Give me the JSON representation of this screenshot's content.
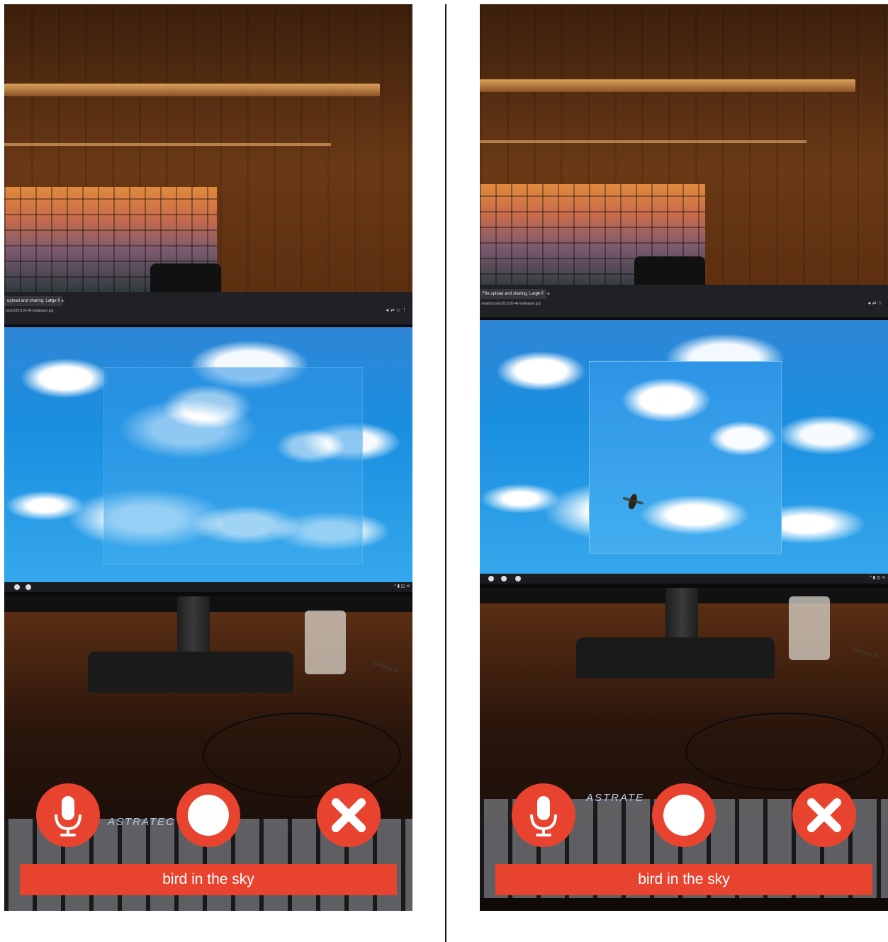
{
  "panels": [
    {
      "browser": {
        "tab_title": "upload and sharing. Large fi",
        "tab_close": "×",
        "new_tab": "+",
        "url": "posts/351193-4k-wallpaper.jpg",
        "toolbar": "● ⇄ ☆ ⋮"
      },
      "tray": "^ ▮ ◫ ⊲",
      "desk_label": "Galaxy A",
      "keyboard_label": "ASTRATEC",
      "caption": "bird in the sky",
      "controls": {
        "mic_icon": "microphone-icon",
        "shutter_icon": "shutter-icon",
        "close_icon": "close-icon"
      },
      "shows_bird": false
    },
    {
      "browser": {
        "tab_title": "File upload and sharing. Large fi",
        "tab_close": "×",
        "new_tab": "+",
        "url": "oloads/posts/351193-4k-wallpaper.jpg",
        "toolbar": "● ⇄ ☆"
      },
      "tray": "^ ▮ ◫ ⊲",
      "desk_label": "Galaxy A",
      "keyboard_label": "ASTRATE",
      "caption": "bird in the sky",
      "controls": {
        "mic_icon": "microphone-icon",
        "shutter_icon": "shutter-icon",
        "close_icon": "close-icon"
      },
      "shows_bird": true
    }
  ],
  "colors": {
    "accent": "#e8432f",
    "icon": "#ffffff",
    "divider": "#1a1a1a"
  }
}
